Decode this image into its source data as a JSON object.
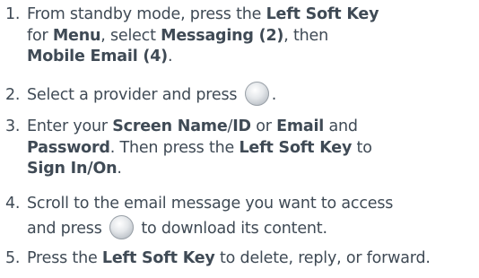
{
  "steps": [
    {
      "number": "1.",
      "l1a": "From standby mode, press the ",
      "l1b": "Left Soft Key",
      "l2a": "for ",
      "l2b": "Menu",
      "l2c": ", select ",
      "l2d": "Messaging (2)",
      "l2e": ", then",
      "l3a": "Mobile Email (4)",
      "l3b": "."
    },
    {
      "number": "2.",
      "l1a": "Select a provider and press ",
      "l1b": "."
    },
    {
      "number": "3.",
      "l1a": "Enter your ",
      "l1b": "Screen Name",
      "l1c": "/",
      "l1d": "ID",
      "l1e": " or ",
      "l1f": "Email",
      "l1g": " and",
      "l2a": "Password",
      "l2b": ". Then press the ",
      "l2c": "Left Soft Key",
      "l2d": " to",
      "l3a": "Sign In/On",
      "l3b": "."
    },
    {
      "number": "4.",
      "l1a": "Scroll to the email message you want to access",
      "l2a": "and press ",
      "l2b": " to download its content."
    },
    {
      "number": "5.",
      "l1a": "Press the ",
      "l1b": "Left Soft Key",
      "l1c": " to delete, reply, or forward."
    }
  ]
}
